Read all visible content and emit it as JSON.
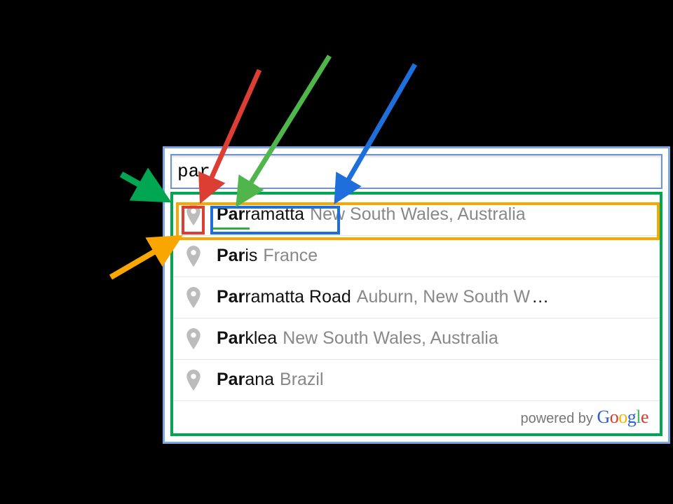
{
  "search": {
    "value": "par"
  },
  "suggestions": [
    {
      "bold": "Par",
      "rest": "ramatta",
      "secondary": "New South Wales, Australia",
      "ellipsis": ""
    },
    {
      "bold": "Par",
      "rest": "is",
      "secondary": "France",
      "ellipsis": ""
    },
    {
      "bold": "Par",
      "rest": "ramatta Road",
      "secondary": "Auburn, New South W",
      "ellipsis": "…"
    },
    {
      "bold": "Par",
      "rest": "klea",
      "secondary": "New South Wales, Australia",
      "ellipsis": ""
    },
    {
      "bold": "Par",
      "rest": "ana",
      "secondary": "Brazil",
      "ellipsis": ""
    }
  ],
  "attribution": {
    "prefix": "powered by "
  },
  "annotation_colors": {
    "container": "#00a651",
    "item": "#f9a700",
    "icon": "#dc3e33",
    "main_text_bold": "#2fae3c",
    "main_text": "#1e6fdc"
  }
}
